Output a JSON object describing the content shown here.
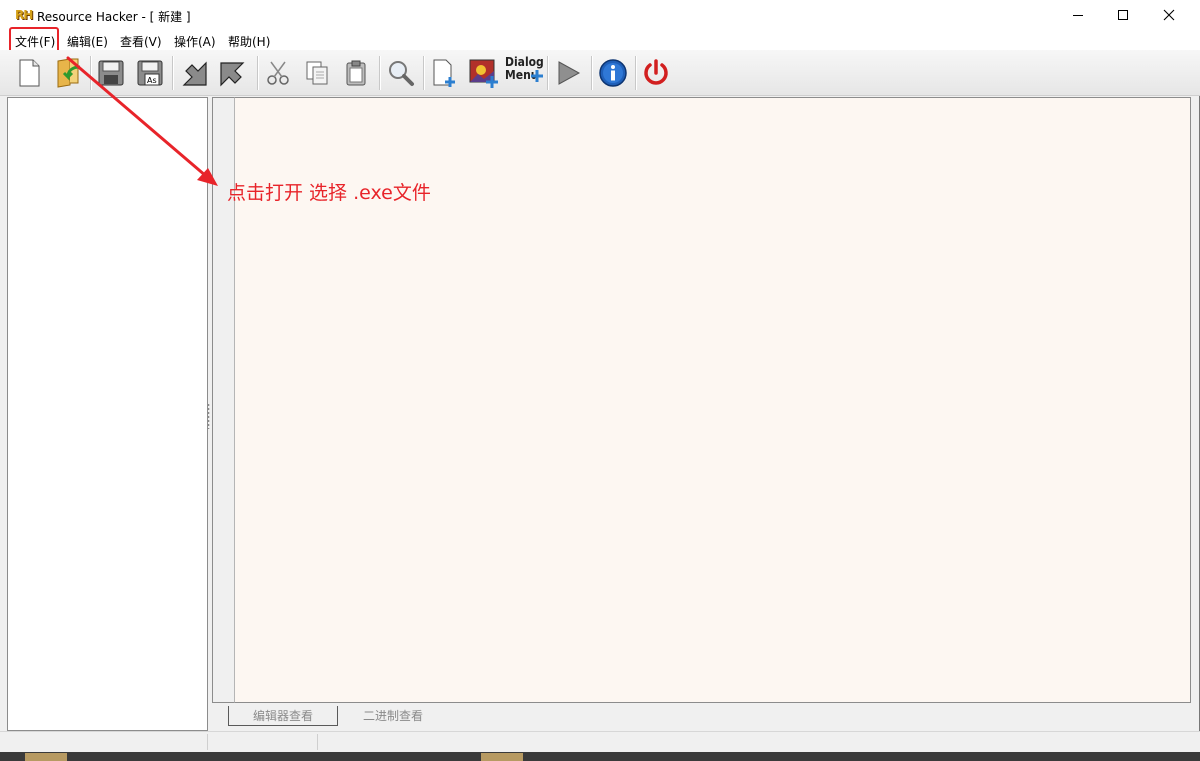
{
  "window": {
    "logo": "RH",
    "title": "Resource Hacker - [ 新建 ]"
  },
  "menu": {
    "items": [
      {
        "label": "文件(F)"
      },
      {
        "label": "编辑(E)"
      },
      {
        "label": "查看(V)"
      },
      {
        "label": "操作(A)"
      },
      {
        "label": "帮助(H)"
      }
    ]
  },
  "toolbar": {
    "dialog_menu_line1": "Dialog",
    "dialog_menu_line2": "Menu",
    "icons": [
      "new-file-icon",
      "open-folder-icon",
      "save-icon",
      "save-as-icon",
      "compile-back-icon",
      "compile-forward-icon",
      "cut-icon",
      "copy-icon",
      "paste-icon",
      "find-icon",
      "add-resource-icon",
      "add-image-icon",
      "dialog-menu-icon",
      "run-icon",
      "about-icon",
      "exit-icon"
    ]
  },
  "tabs": [
    {
      "label": "编辑器查看",
      "active": true
    },
    {
      "label": "二进制查看",
      "active": false
    }
  ],
  "annotation": {
    "text": "点击打开  选择 .exe文件"
  },
  "colors": {
    "annotation_red": "#e8242a",
    "editor_bg": "#fdf7f2"
  }
}
